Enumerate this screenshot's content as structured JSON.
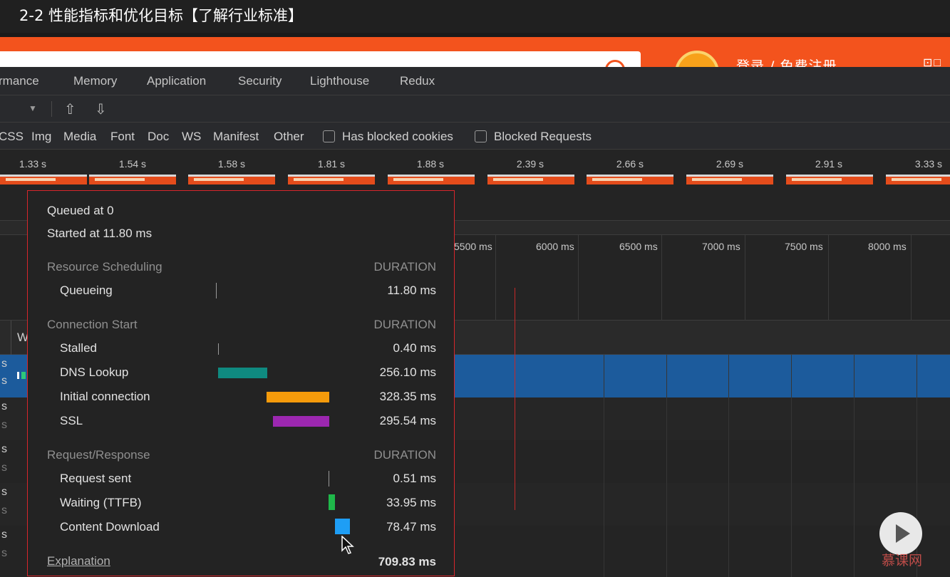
{
  "video": {
    "title": "2-2 性能指标和优化目标【了解行业标准】"
  },
  "site": {
    "login_text": "登录 / 免费注册",
    "window_icons": "⊡□"
  },
  "panel_tabs": [
    "rmance",
    "Memory",
    "Application",
    "Security",
    "Lighthouse",
    "Redux"
  ],
  "filter": {
    "types": [
      "CSS",
      "Img",
      "Media",
      "Font",
      "Doc",
      "WS",
      "Manifest",
      "Other"
    ],
    "has_blocked_cookies": "Has blocked cookies",
    "blocked_requests": "Blocked Requests"
  },
  "screenshots": [
    "1.33 s",
    "1.54 s",
    "1.58 s",
    "1.81 s",
    "1.88 s",
    "2.39 s",
    "2.66 s",
    "2.69 s",
    "2.91 s",
    "3.33 s"
  ],
  "overview_ticks": [
    "5500 ms",
    "6000 ms",
    "6500 ms",
    "7000 ms",
    "7500 ms",
    "8000 ms"
  ],
  "waterfall": {
    "column_label": "W"
  },
  "row_marks": [
    "s",
    "s",
    "s",
    "s",
    "s",
    "s",
    "s",
    "s",
    "s",
    "s"
  ],
  "timing": {
    "queued_at": "Queued at 0",
    "started_at": "Started at 11.80 ms",
    "sections": [
      {
        "title": "Resource Scheduling",
        "duration_label": "DURATION",
        "items": [
          {
            "label": "Queueing",
            "value": "11.80 ms",
            "color": "#9a9a9a"
          }
        ]
      },
      {
        "title": "Connection Start",
        "duration_label": "DURATION",
        "items": [
          {
            "label": "Stalled",
            "value": "0.40 ms",
            "color": "#9a9a9a"
          },
          {
            "label": "DNS Lookup",
            "value": "256.10 ms",
            "color": "#0f8a80"
          },
          {
            "label": "Initial connection",
            "value": "328.35 ms",
            "color": "#f59b0b"
          },
          {
            "label": "SSL",
            "value": "295.54 ms",
            "color": "#9c27b0"
          }
        ]
      },
      {
        "title": "Request/Response",
        "duration_label": "DURATION",
        "items": [
          {
            "label": "Request sent",
            "value": "0.51 ms",
            "color": "#9a9a9a"
          },
          {
            "label": "Waiting (TTFB)",
            "value": "33.95 ms",
            "color": "#1fb84a"
          },
          {
            "label": "Content Download",
            "value": "78.47 ms",
            "color": "#1e9ef5"
          }
        ]
      }
    ],
    "explanation": "Explanation",
    "total": "709.83 ms"
  },
  "watermark": "慕课网"
}
